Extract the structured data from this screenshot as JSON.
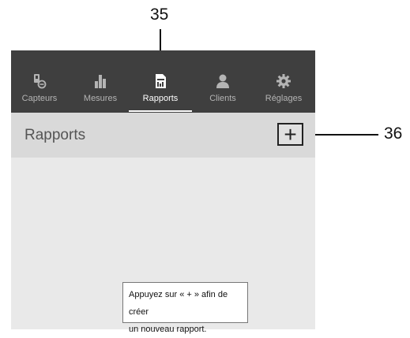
{
  "callouts": {
    "nav_rapports": "35",
    "add_button": "36"
  },
  "nav": {
    "items": [
      {
        "label": "Capteurs",
        "icon": "sensor-icon",
        "active": false
      },
      {
        "label": "Mesures",
        "icon": "bar-chart-icon",
        "active": false
      },
      {
        "label": "Rapports",
        "icon": "report-icon",
        "active": true
      },
      {
        "label": "Clients",
        "icon": "person-icon",
        "active": false
      },
      {
        "label": "Réglages",
        "icon": "gear-icon",
        "active": false
      }
    ]
  },
  "header": {
    "title": "Rapports",
    "add_symbol": "+"
  },
  "hint": {
    "line1": "Appuyez sur « + » afin de créer",
    "line2": "un nouveau rapport."
  },
  "colors": {
    "navbar": "#3f3f3f",
    "header": "#d9d9d9",
    "content": "#e9e9e9",
    "nav_inactive": "#b4b4b4",
    "nav_active": "#ffffff"
  }
}
